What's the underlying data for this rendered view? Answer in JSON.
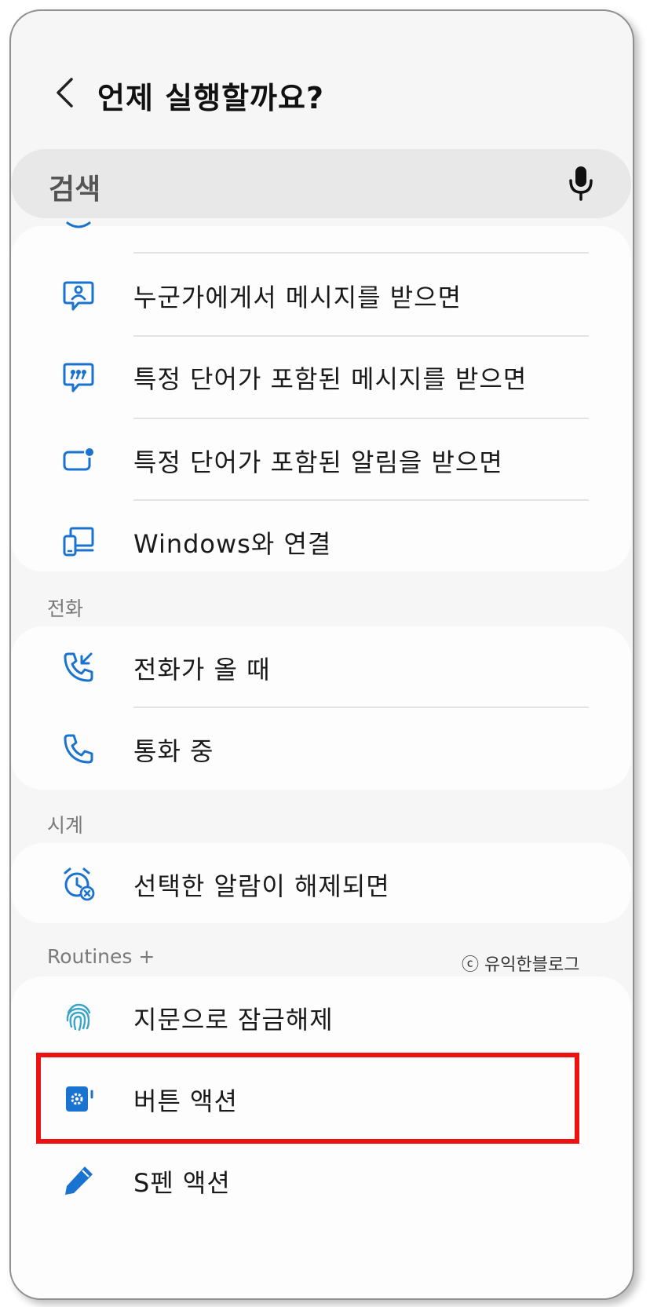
{
  "header": {
    "title": "언제 실행할까요?"
  },
  "search": {
    "label": "검색"
  },
  "sections": {
    "call": "전화",
    "clock": "시계",
    "routines": "Routines +"
  },
  "items": {
    "message_from": "누군가에게서 메시지를 받으면",
    "message_words": "특정 단어가 포함된 메시지를 받으면",
    "notification_words": "특정 단어가 포함된 알림을 받으면",
    "windows": "Windows와 연결",
    "incoming_call": "전화가 올 때",
    "on_call": "통화 중",
    "alarm_dismiss": "선택한 알람이 해제되면",
    "fingerprint": "지문으로 잠금해제",
    "button_action": "버튼 액션",
    "spen_action": "S펜 액션"
  },
  "watermark": "ⓒ 유익한블로그",
  "colors": {
    "accent": "#1a73d0",
    "highlight": "#ee1111"
  },
  "icons": {
    "back": "chevron-left-icon",
    "mic": "microphone-icon",
    "message_from": "message-person-icon",
    "message_words": "message-quote-icon",
    "notification_words": "notification-dot-icon",
    "windows": "devices-icon",
    "incoming_call": "incoming-call-icon",
    "on_call": "phone-icon",
    "alarm_dismiss": "alarm-off-icon",
    "fingerprint": "fingerprint-icon",
    "button_action": "side-button-icon",
    "spen_action": "pen-icon"
  }
}
